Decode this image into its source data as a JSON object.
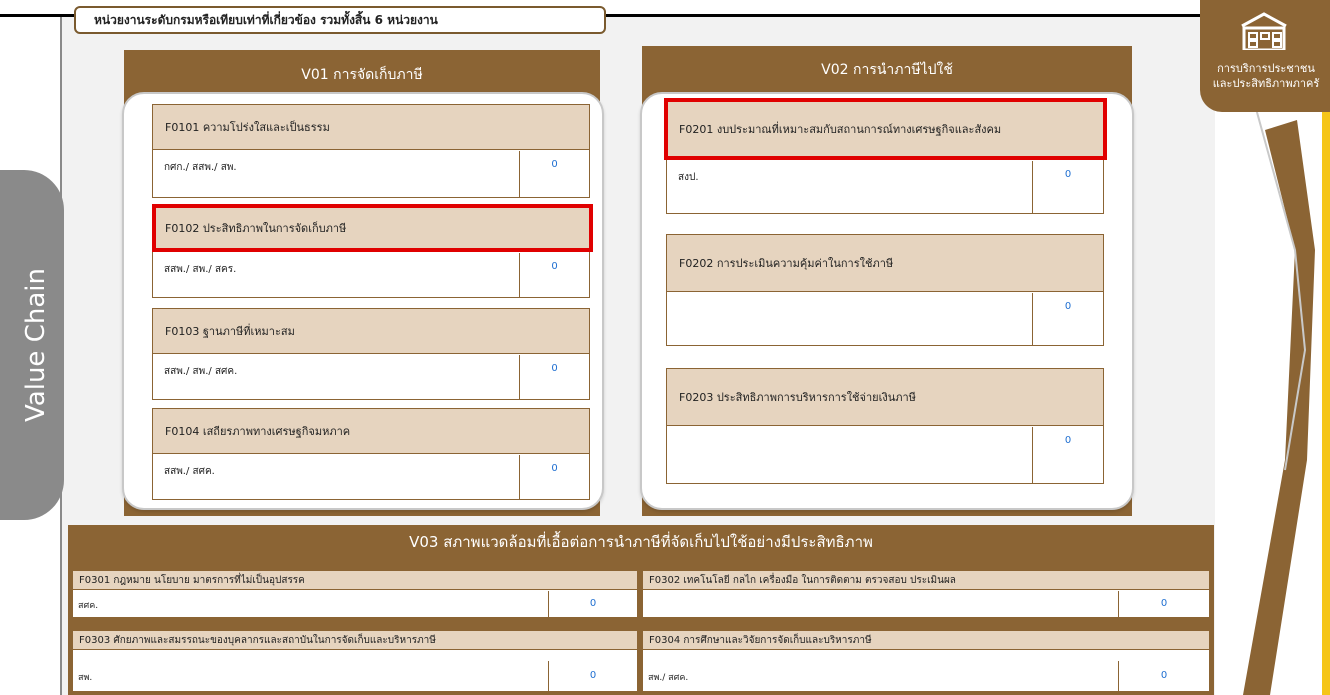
{
  "header": {
    "title": "หน่วยงานระดับกรมหรือเทียบเท่าที่เกี่ยวข้อง รวมทั้งสิ้น 6 หน่วยงาน"
  },
  "side_tab": {
    "label": "Value Chain"
  },
  "badge": {
    "line1": "การบริการประชาชน",
    "line2": "และประสิทธิภาพภาครั",
    "icon": "building-icon"
  },
  "v01": {
    "title": "V01 การจัดเก็บภาษี",
    "items": [
      {
        "title": "F0101 ความโปร่งใสและเป็นธรรม",
        "agency": "กศก./ สสพ./ สพ.",
        "count": "0"
      },
      {
        "title": "F0102 ประสิทธิภาพในการจัดเก็บภาษี",
        "agency": "สสพ./ สพ./ สคร.",
        "count": "0"
      },
      {
        "title": "F0103 ฐานภาษีที่เหมาะสม",
        "agency": "สสพ./ สพ./ สศค.",
        "count": "0"
      },
      {
        "title": "F0104 เสถียรภาพทางเศรษฐกิจมหภาค",
        "agency": "สสพ./ สศค.",
        "count": "0"
      }
    ]
  },
  "v02": {
    "title": "V02 การนำภาษีไปใช้",
    "items": [
      {
        "title": "F0201 งบประมาณที่เหมาะสมกับสถานการณ์ทางเศรษฐกิจและสังคม",
        "agency": "สงป.",
        "count": "0"
      },
      {
        "title": "F0202 การประเมินความคุ้มค่าในการใช้ภาษี",
        "agency": "",
        "count": "0"
      },
      {
        "title": "F0203 ประสิทธิภาพการบริหารการใช้จ่ายเงินภาษี",
        "agency": "",
        "count": "0"
      }
    ]
  },
  "v03": {
    "title": "V03 สภาพแวดล้อมที่เอื้อต่อการนำภาษีที่จัดเก็บไปใช้อย่างมีประสิทธิภาพ",
    "items": [
      {
        "title": "F0301 กฎหมาย นโยบาย มาตรการที่ไม่เป็นอุปสรรค",
        "agency": "สศค.",
        "count": "0"
      },
      {
        "title": "F0302 เทคโนโลยี กลไก เครื่องมือ ในการติดตาม ตรวจสอบ ประเมินผล",
        "agency": "",
        "count": "0"
      },
      {
        "title": "F0303 ศักยภาพและสมรรถนะของบุคลากรและสถาบันในการจัดเก็บและบริหารภาษี",
        "agency": "สพ.",
        "count": "0"
      },
      {
        "title": "F0304 การศึกษาและวิจัยการจัดเก็บและบริหารภาษี",
        "agency": "สพ./ สศค.",
        "count": "0"
      }
    ]
  }
}
